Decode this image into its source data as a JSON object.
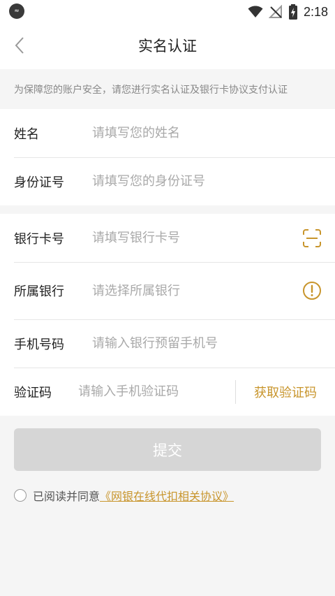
{
  "status_bar": {
    "time": "2:18",
    "app_icon_text": "≈"
  },
  "nav": {
    "title": "实名认证"
  },
  "notice": {
    "text": "为保障您的账户安全，请您进行实名认证及银行卡协议支付认证"
  },
  "identity": {
    "name_label": "姓名",
    "name_placeholder": "请填写您的姓名",
    "id_label": "身份证号",
    "id_placeholder": "请填写您的身份证号"
  },
  "bank": {
    "card_label": "银行卡号",
    "card_placeholder": "请填写银行卡号",
    "bank_label": "所属银行",
    "bank_placeholder": "请选择所属银行",
    "phone_label": "手机号码",
    "phone_placeholder": "请输入银行预留手机号",
    "code_label": "验证码",
    "code_placeholder": "请输入手机验证码",
    "get_code_label": "获取验证码"
  },
  "submit": {
    "label": "提交"
  },
  "agreement": {
    "prefix": "已阅读并同意",
    "link": "《网银在线代扣相关协议》"
  },
  "colors": {
    "accent": "#c8952c",
    "submit_disabled": "#d6d6d6",
    "background": "#f5f5f5"
  },
  "icons": {
    "back": "back-arrow-icon",
    "scan": "scan-icon",
    "info": "exclamation-circle-icon",
    "wifi": "wifi-icon",
    "signal": "no-signal-icon",
    "battery": "battery-charging-icon"
  }
}
